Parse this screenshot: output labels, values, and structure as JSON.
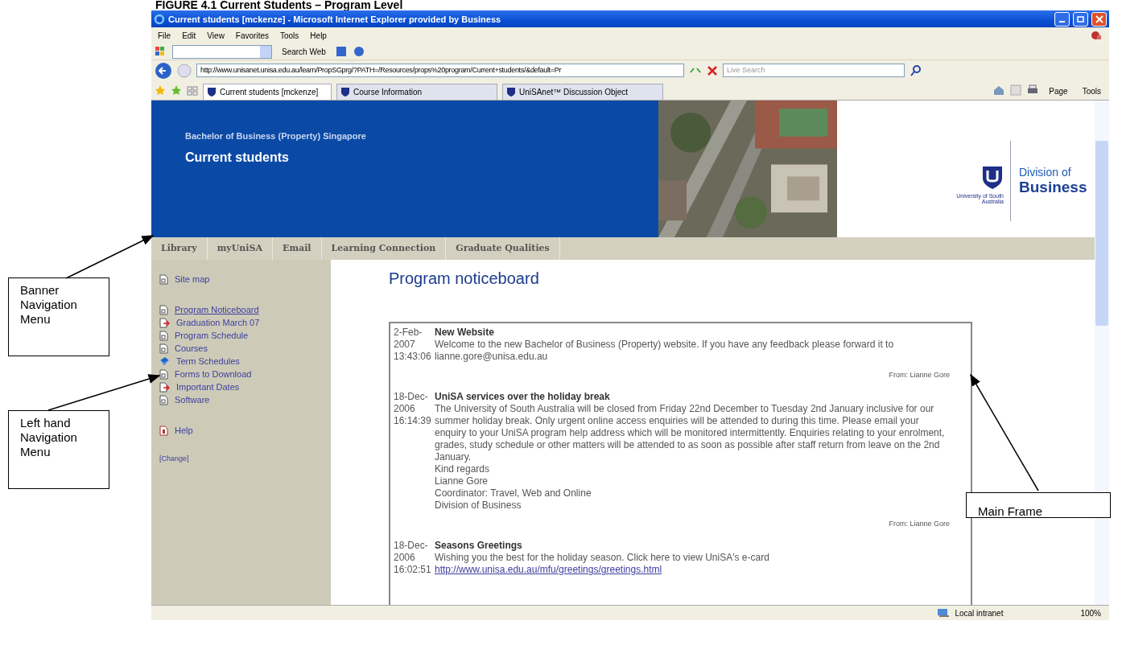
{
  "caption": "FIGURE 4.1 Current Students – Program Level",
  "window": {
    "title": "Current students [mckenze] - Microsoft Internet Explorer provided by Business"
  },
  "menu": [
    "File",
    "Edit",
    "View",
    "Favorites",
    "Tools",
    "Help"
  ],
  "toolbar": {
    "search_button": "Search Web"
  },
  "address": {
    "value": "http://www.unisanet.unisa.edu.au/learn/PropSGprg/?PATH=/Resources/props%20program/Current+students/&default=Pr"
  },
  "search": {
    "placeholder": "Live Search"
  },
  "tabs": [
    {
      "label": "Current students [mckenze]",
      "selected": true
    },
    {
      "label": "Course Information",
      "selected": false
    },
    {
      "label": "UniSAnet™ Discussion Object",
      "selected": false
    }
  ],
  "command_bar": [
    "Page",
    "Tools"
  ],
  "banner": {
    "subtitle": "Bachelor of Business (Property) Singapore",
    "title": "Current students",
    "logo_text": "University of South Australia",
    "division": "Division of",
    "division_name": "Business"
  },
  "banner_nav": [
    "Library",
    "myUniSA",
    "Email",
    "Learning Connection",
    "Graduate Qualities"
  ],
  "sidebar": {
    "groups": [
      [
        {
          "label": "Site map",
          "kind": "page",
          "selected": false
        }
      ],
      [
        {
          "label": "Program Noticeboard",
          "kind": "page",
          "selected": true
        },
        {
          "label": "Graduation March 07",
          "kind": "redirect",
          "selected": false
        },
        {
          "label": "Program Schedule",
          "kind": "page",
          "selected": false
        },
        {
          "label": "Courses",
          "kind": "page",
          "selected": false
        },
        {
          "label": "Term Schedules",
          "kind": "book",
          "selected": false
        },
        {
          "label": "Forms to Download",
          "kind": "page",
          "selected": false
        },
        {
          "label": "Important Dates",
          "kind": "redirect",
          "selected": false
        },
        {
          "label": "Software",
          "kind": "page",
          "selected": false
        }
      ],
      [
        {
          "label": "Help",
          "kind": "help",
          "selected": false
        }
      ]
    ],
    "change": "[Change]"
  },
  "main": {
    "heading": "Program noticeboard",
    "notices": [
      {
        "date": [
          "2-Feb-",
          "2007",
          "13:43:06"
        ],
        "title": "New Website",
        "paragraphs": [
          "Welcome to the new Bachelor of Business (Property) website. If you have any feedback please forward it to lianne.gore@unisa.edu.au"
        ],
        "from": "From: Lianne Gore"
      },
      {
        "date": [
          "18-Dec-",
          "2006",
          "16:14:39"
        ],
        "title": "UniSA services over the holiday break",
        "paragraphs": [
          "The University of South Australia will be closed from Friday 22nd December to Tuesday 2nd January inclusive for our summer holiday break. Only urgent online access enquiries will be attended to during this time. Please email your enquiry to your UniSA program help address which will be monitored intermittently. Enquiries relating to your enrolment, grades, study schedule or other matters will be attended to as soon as possible after staff return from leave on the 2nd January.",
          "Kind regards",
          "Lianne Gore",
          "Coordinator: Travel, Web and Online",
          "Division of Business"
        ],
        "from": "From: Lianne Gore"
      },
      {
        "date": [
          "18-Dec-",
          "2006",
          "16:02:51"
        ],
        "title": "Seasons Greetings",
        "paragraphs": [
          "Wishing you the best for the holiday season. Click here to view UniSA's e-card"
        ],
        "link": "http://www.unisa.edu.au/mfu/greetings/greetings.html"
      }
    ]
  },
  "status_bar": {
    "zone": "Local intranet",
    "zoom": "100%"
  },
  "annotations": [
    "Banner Navigation Menu",
    "Left hand Navigation Menu",
    "Main Frame"
  ]
}
